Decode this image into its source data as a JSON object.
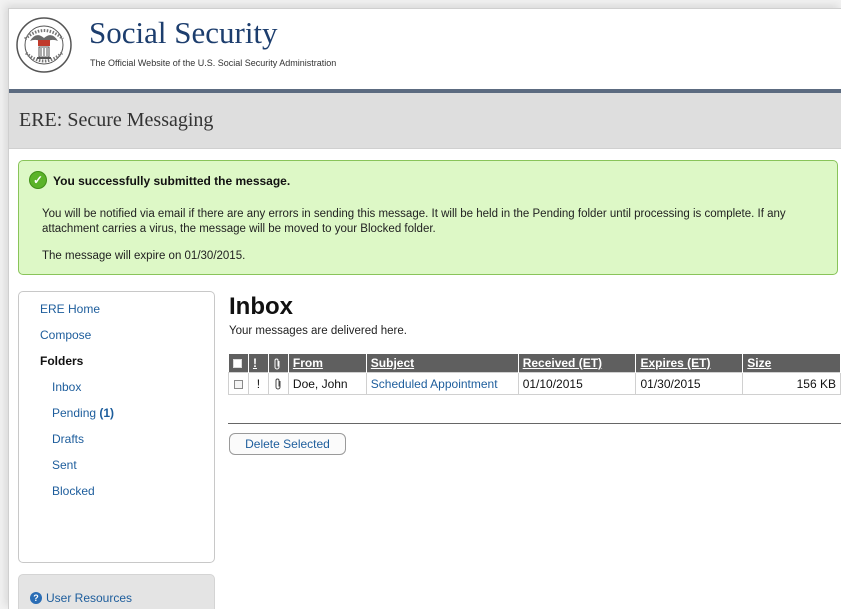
{
  "header": {
    "site_title": "Social Security",
    "tagline": "The Official Website of the U.S. Social Security Administration",
    "seal_icon": "ssa-seal-icon"
  },
  "page": {
    "heading": "ERE: Secure Messaging"
  },
  "alert": {
    "icon": "check-circle-icon",
    "title": "You successfully submitted the message.",
    "body": "You will be notified via email if there are any errors in sending this message. It will be held in the Pending folder until processing is complete. If any attachment carries a virus, the message will be moved to your Blocked folder.",
    "expire_text": "The message will expire on 01/30/2015.",
    "bg_color": "#ddf8c6",
    "border_color": "#89c45a"
  },
  "sidebar": {
    "ere_home": "ERE Home",
    "compose": "Compose",
    "folders": "Folders",
    "inbox": "Inbox",
    "pending": "Pending",
    "pending_count": "(1)",
    "drafts": "Drafts",
    "sent": "Sent",
    "blocked": "Blocked"
  },
  "resources": {
    "label": "User Resources",
    "icon": "help-icon"
  },
  "inbox": {
    "title": "Inbox",
    "subtitle": "Your messages are delivered here.",
    "columns": {
      "priority": "!",
      "from": "From",
      "subject": "Subject",
      "received": "Received (ET)",
      "expires": "Expires (ET)",
      "size": "Size"
    },
    "rows": [
      {
        "priority": "!",
        "from": "Doe, John",
        "subject": "Scheduled Appointment",
        "received": "01/10/2015",
        "expires": "01/30/2015",
        "size": "156 KB"
      }
    ],
    "delete_button": "Delete Selected"
  },
  "colors": {
    "brand": "#1d3e6e",
    "link": "#1d5d9c",
    "table_header": "#5f5f5f"
  }
}
